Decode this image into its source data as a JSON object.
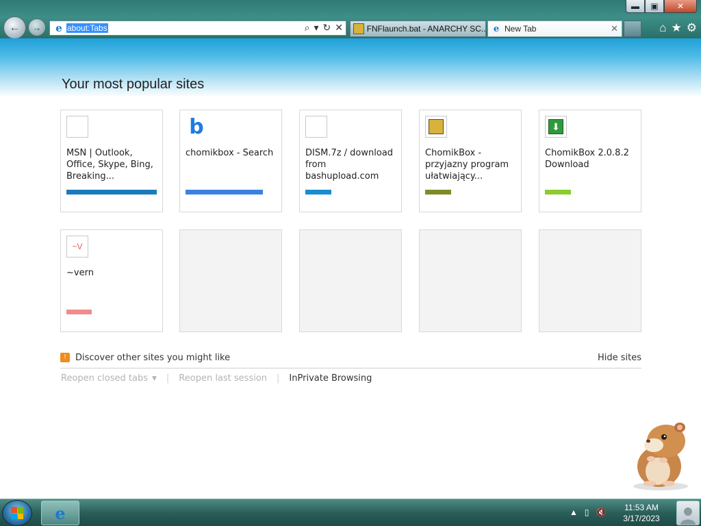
{
  "window": {
    "controls": {
      "minimize": "▬",
      "maximize": "▣",
      "close": "✕"
    }
  },
  "navigation": {
    "back_icon": "arrow-left-icon",
    "forward_icon": "arrow-right-icon",
    "back_glyph": "←",
    "forward_glyph": "→"
  },
  "address_bar": {
    "value": "about:Tabs",
    "actions": [
      "⌕",
      "▾",
      "↻",
      "✕"
    ]
  },
  "tabs": [
    {
      "label": "FNFlaunch.bat - ANARCHY SC...",
      "active": false
    },
    {
      "label": "New Tab",
      "active": true,
      "close": "✕"
    }
  ],
  "command_icons": {
    "home": "⌂",
    "favorites": "★",
    "tools": "⚙"
  },
  "page": {
    "title": "Your most popular sites",
    "tiles": [
      {
        "title": "MSN | Outlook, Office, Skype, Bing, Breaking...",
        "icon": "blank-icon",
        "bar_color": "#1a7bbd",
        "bar_fraction": 1.0
      },
      {
        "title": "chomikbox - Search",
        "icon": "bing-icon",
        "icon_glyph": "b",
        "bar_color": "#3b82e0",
        "bar_fraction": 0.86
      },
      {
        "title": "DISM.7z / download from bashupload.com",
        "icon": "blank-icon",
        "bar_color": "#1a8ccf",
        "bar_fraction": 0.29
      },
      {
        "title": "ChomikBox - przyjazny program ułatwiający...",
        "icon": "chomikbox-icon",
        "bar_color": "#7f8a28",
        "bar_fraction": 0.29
      },
      {
        "title": "ChomikBox 2.0.8.2 Download",
        "icon": "download-arrow-icon",
        "icon_glyph": "⬇",
        "bar_color": "#8ccc2e",
        "bar_fraction": 0.29
      },
      {
        "title": "~vern",
        "icon": "vern-icon",
        "icon_glyph": "~V",
        "bar_color": "#f08c8c",
        "bar_fraction": 0.28
      }
    ],
    "discover": {
      "label": "Discover other sites you might like",
      "hide": "Hide sites",
      "icon_glyph": "!"
    },
    "links": {
      "reopen_closed": "Reopen closed tabs",
      "reopen_caret": "▼",
      "separator": "|",
      "reopen_last": "Reopen last session",
      "inprivate": "InPrivate Browsing"
    }
  },
  "taskbar": {
    "ie_glyph": "e",
    "tray_icons": [
      "▲",
      "▯",
      "🔇"
    ],
    "time": "11:53 AM",
    "date": "3/17/2023"
  }
}
